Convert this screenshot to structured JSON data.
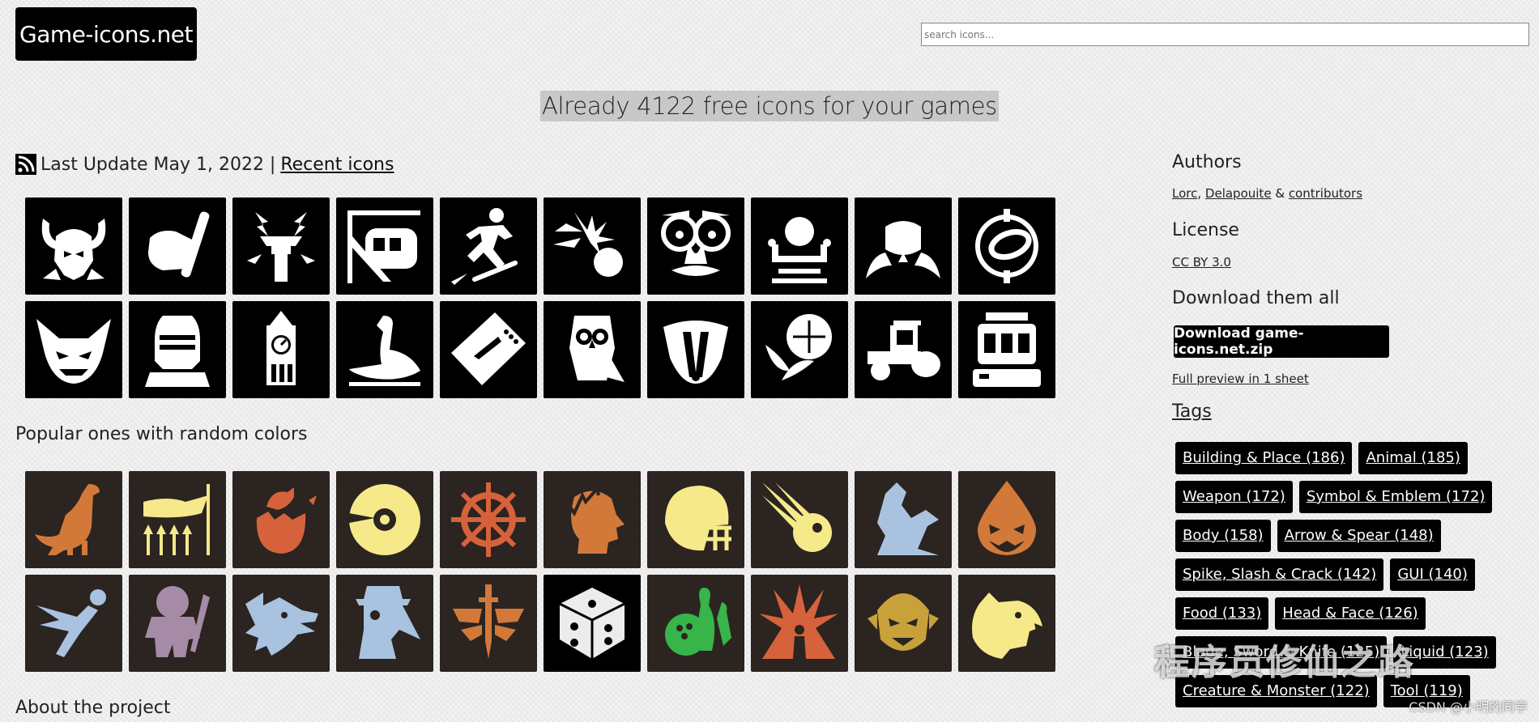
{
  "header": {
    "logo_text": "Game-icons.net",
    "search_placeholder": "search icons..."
  },
  "headline": "Already 4122 free icons for your games",
  "update": {
    "text": "Last Update May 1, 2022 |",
    "link": "Recent icons"
  },
  "recent_icons": [
    "horned-helmet-icon",
    "hand-tube-icon",
    "lightning-tower-icon",
    "tram-icon",
    "skateboarder-icon",
    "comet-ball-icon",
    "disguise-glasses-icon",
    "orb-machine-icon",
    "shield-wings-icon",
    "portal-ring-icon",
    "imp-face-icon",
    "knight-helmet-icon",
    "clock-tower-icon",
    "swan-icon",
    "plane-ticket-icon",
    "owl-icon",
    "badger-icon",
    "artichoke-icon",
    "tractor-icon",
    "slot-machine-icon"
  ],
  "popular_title": "Popular ones with random colors",
  "popular_icons": [
    {
      "name": "dinosaur-icon",
      "color": "#d2793a",
      "bg": "#2b2420"
    },
    {
      "name": "banner-spears-icon",
      "color": "#f5e98a",
      "bg": "#2b2420"
    },
    {
      "name": "hatching-egg-icon",
      "color": "#d6623c",
      "bg": "#2b2420"
    },
    {
      "name": "disc-icon",
      "color": "#f5e98a",
      "bg": "#2b2420"
    },
    {
      "name": "ship-wheel-icon",
      "color": "#d6623c",
      "bg": "#2b2420"
    },
    {
      "name": "laurel-head-icon",
      "color": "#d2793a",
      "bg": "#2b2420"
    },
    {
      "name": "football-helmet-icon",
      "color": "#f5e98a",
      "bg": "#2b2420"
    },
    {
      "name": "meteor-icon",
      "color": "#f5e98a",
      "bg": "#2b2420"
    },
    {
      "name": "sphinx-icon",
      "color": "#a9c2df",
      "bg": "#2b2420"
    },
    {
      "name": "pumpkin-drop-icon",
      "color": "#d2793a",
      "bg": "#2b2420"
    },
    {
      "name": "running-strike-icon",
      "color": "#a9c2df",
      "bg": "#2b2420"
    },
    {
      "name": "troll-icon",
      "color": "#a68ba6",
      "bg": "#2b2420"
    },
    {
      "name": "wolf-head-icon",
      "color": "#a9c2df",
      "bg": "#2b2420"
    },
    {
      "name": "plague-doctor-icon",
      "color": "#a9c2df",
      "bg": "#2b2420"
    },
    {
      "name": "winged-sword-icon",
      "color": "#d2793a",
      "bg": "#2b2420"
    },
    {
      "name": "dice-icon",
      "color": "#ececec",
      "bg": "#000000"
    },
    {
      "name": "bowling-icon",
      "color": "#37b44a",
      "bg": "#2b2420"
    },
    {
      "name": "explosion-silhouette-icon",
      "color": "#d6623c",
      "bg": "#2b2420"
    },
    {
      "name": "vampire-icon",
      "color": "#c9a13a",
      "bg": "#2b2420"
    },
    {
      "name": "bear-head-icon",
      "color": "#f5e98a",
      "bg": "#2b2420"
    }
  ],
  "about_title": "About the project",
  "sidebar": {
    "authors_title": "Authors",
    "author_lorc": "Lorc",
    "author_sep": ",",
    "author_delapouite": "Delapouite",
    "author_amp": "&",
    "author_contributors": "contributors",
    "license_title": "License",
    "license_link": "CC BY 3.0",
    "download_title": "Download them all",
    "download_button": "Download game-icons.net.zip",
    "preview_link": "Full preview in 1 sheet",
    "tags_title": "Tags",
    "tags": [
      "Building & Place (186)",
      "Animal (185)",
      "Weapon (172)",
      "Symbol & Emblem (172)",
      "Body (158)",
      "Arrow & Spear (148)",
      "Spike, Slash & Crack (142)",
      "GUI (140)",
      "Food (133)",
      "Head & Face (126)",
      "Blade, Sword & Knife (125)",
      "Liquid (123)",
      "Creature & Monster (122)",
      "Tool (119)"
    ]
  },
  "watermark": "程序员修仙之路",
  "csdn_mark": "CSDN @小明的同学"
}
